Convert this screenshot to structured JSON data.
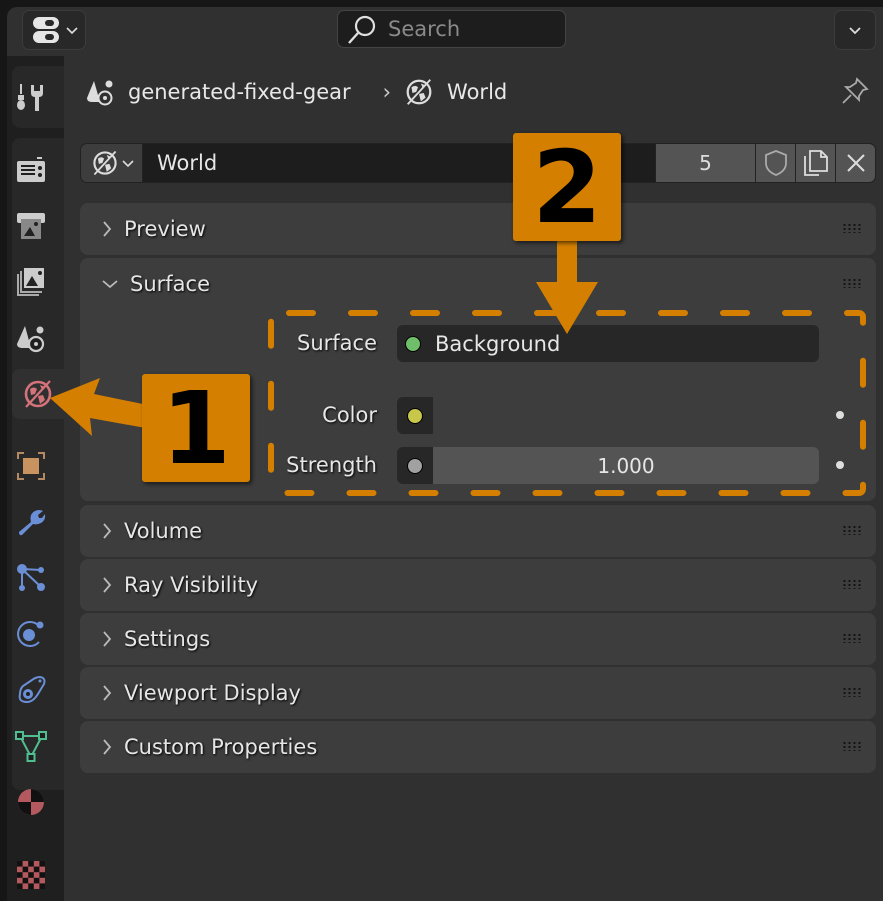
{
  "header": {
    "search_placeholder": "Search",
    "editor_type_icon": "properties-editor-icon",
    "options_icon": "chevron-down-icon"
  },
  "tabs": [
    {
      "name": "tool",
      "icon": "tool-icon"
    },
    {
      "name": "render",
      "icon": "render-icon"
    },
    {
      "name": "output",
      "icon": "output-icon"
    },
    {
      "name": "view-layer",
      "icon": "view-layer-icon"
    },
    {
      "name": "scene",
      "icon": "scene-icon"
    },
    {
      "name": "world",
      "icon": "world-icon",
      "active": true
    },
    {
      "name": "object",
      "icon": "object-icon"
    },
    {
      "name": "modifiers",
      "icon": "wrench-icon"
    },
    {
      "name": "particles",
      "icon": "particles-icon"
    },
    {
      "name": "physics",
      "icon": "physics-icon"
    },
    {
      "name": "constraints",
      "icon": "constraints-icon"
    },
    {
      "name": "data",
      "icon": "mesh-data-icon"
    },
    {
      "name": "material",
      "icon": "material-icon"
    },
    {
      "name": "texture",
      "icon": "texture-icon"
    }
  ],
  "breadcrumb": {
    "scene": "generated-fixed-gear",
    "separator": "›",
    "world": "World"
  },
  "id_block": {
    "name": "World",
    "users": "5"
  },
  "panels": [
    {
      "label": "Preview",
      "expanded": false
    },
    {
      "label": "Surface",
      "expanded": true
    },
    {
      "label": "Volume",
      "expanded": false
    },
    {
      "label": "Ray Visibility",
      "expanded": false
    },
    {
      "label": "Settings",
      "expanded": false
    },
    {
      "label": "Viewport Display",
      "expanded": false
    },
    {
      "label": "Custom Properties",
      "expanded": false
    }
  ],
  "surface": {
    "surface_label": "Surface",
    "surface_value": "Background",
    "color_label": "Color",
    "strength_label": "Strength",
    "strength_value": "1.000"
  },
  "annotations": {
    "marker_1": "1",
    "marker_2": "2",
    "accent": "#d47f00"
  },
  "colors": {
    "shader_socket": "#6fbf6a",
    "color_socket": "#c7c74a",
    "float_socket": "#a1a1a1",
    "world_tab": "#d4737a"
  }
}
